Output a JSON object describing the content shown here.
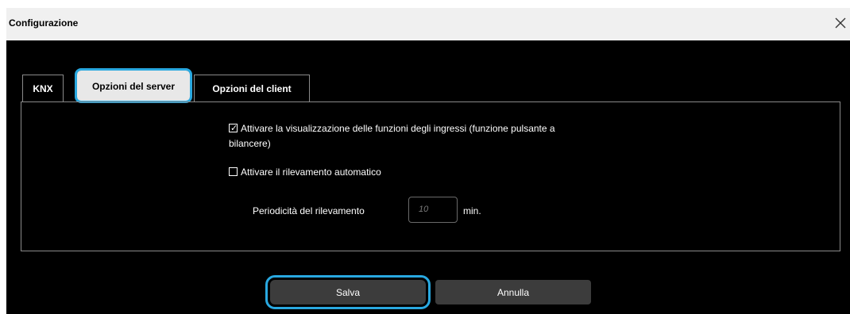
{
  "dialog": {
    "title": "Configurazione"
  },
  "tabs": [
    {
      "label": "KNX",
      "active": false
    },
    {
      "label": "Opzioni del server",
      "active": true
    },
    {
      "label": "Opzioni del client",
      "active": false
    }
  ],
  "server_options": {
    "show_input_functions": {
      "checked": true,
      "label_line1": "Attivare la visualizzazione delle funzioni degli ingressi (funzione pulsante a",
      "label_line2": "bilancere)"
    },
    "auto_detection": {
      "checked": false,
      "label": "Attivare il rilevamento automatico"
    },
    "period": {
      "label": "Periodicità del rilevamento",
      "placeholder": "10",
      "unit": "min."
    }
  },
  "buttons": {
    "save": "Salva",
    "cancel": "Annulla"
  },
  "colors": {
    "focus": "#29a8e0",
    "background": "#000000",
    "titlebar": "#f0f0f0"
  },
  "icons": {
    "close": "close-icon"
  }
}
